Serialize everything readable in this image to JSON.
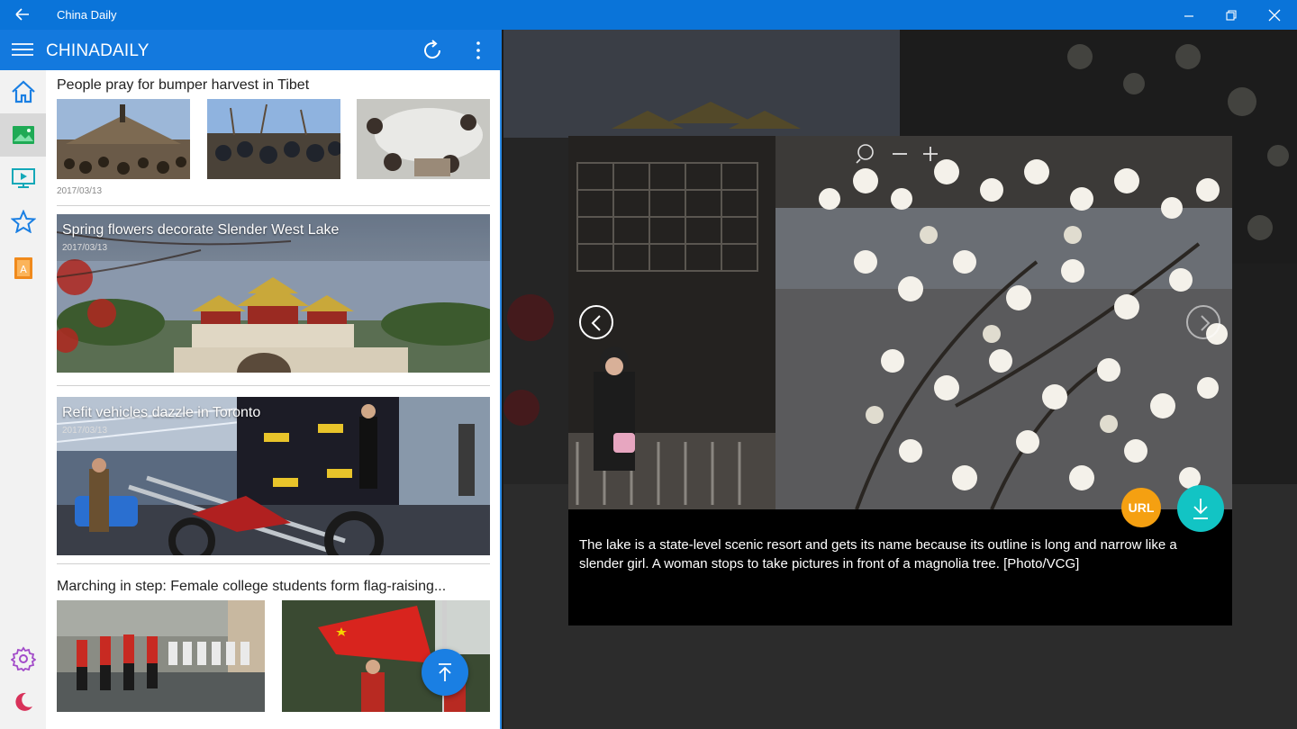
{
  "window": {
    "title": "China Daily"
  },
  "appbar": {
    "brand": "CHINADAILY"
  },
  "nav": {
    "items": [
      {
        "name": "home-icon",
        "selected": false
      },
      {
        "name": "photo-icon",
        "selected": true
      },
      {
        "name": "video-icon",
        "selected": false
      },
      {
        "name": "star-icon",
        "selected": false
      },
      {
        "name": "reader-icon",
        "selected": false
      }
    ],
    "bottom": [
      "settings-icon",
      "night-mode-icon"
    ]
  },
  "articles": [
    {
      "title": "People pray for bumper harvest in Tibet",
      "date": "2017/03/13"
    },
    {
      "title": "Spring flowers decorate Slender West Lake",
      "date": "2017/03/13"
    },
    {
      "title": "Refit vehicles dazzle in Toronto",
      "date": "2017/03/13"
    },
    {
      "title": "Marching in step: Female college students form flag-raising...",
      "date": ""
    }
  ],
  "viewer": {
    "caption": "The lake is a state-level scenic resort and gets its name because its outline is long and narrow like a slender girl. A woman stops to take pictures in front of a magnolia tree. [Photo/VCG]",
    "url_label": "URL"
  },
  "colors": {
    "titlebar": "#0a74d9",
    "appbar": "#1379de",
    "accent": "#1a7fe3",
    "url_button": "#f5a011",
    "download_button": "#12c4c4"
  }
}
